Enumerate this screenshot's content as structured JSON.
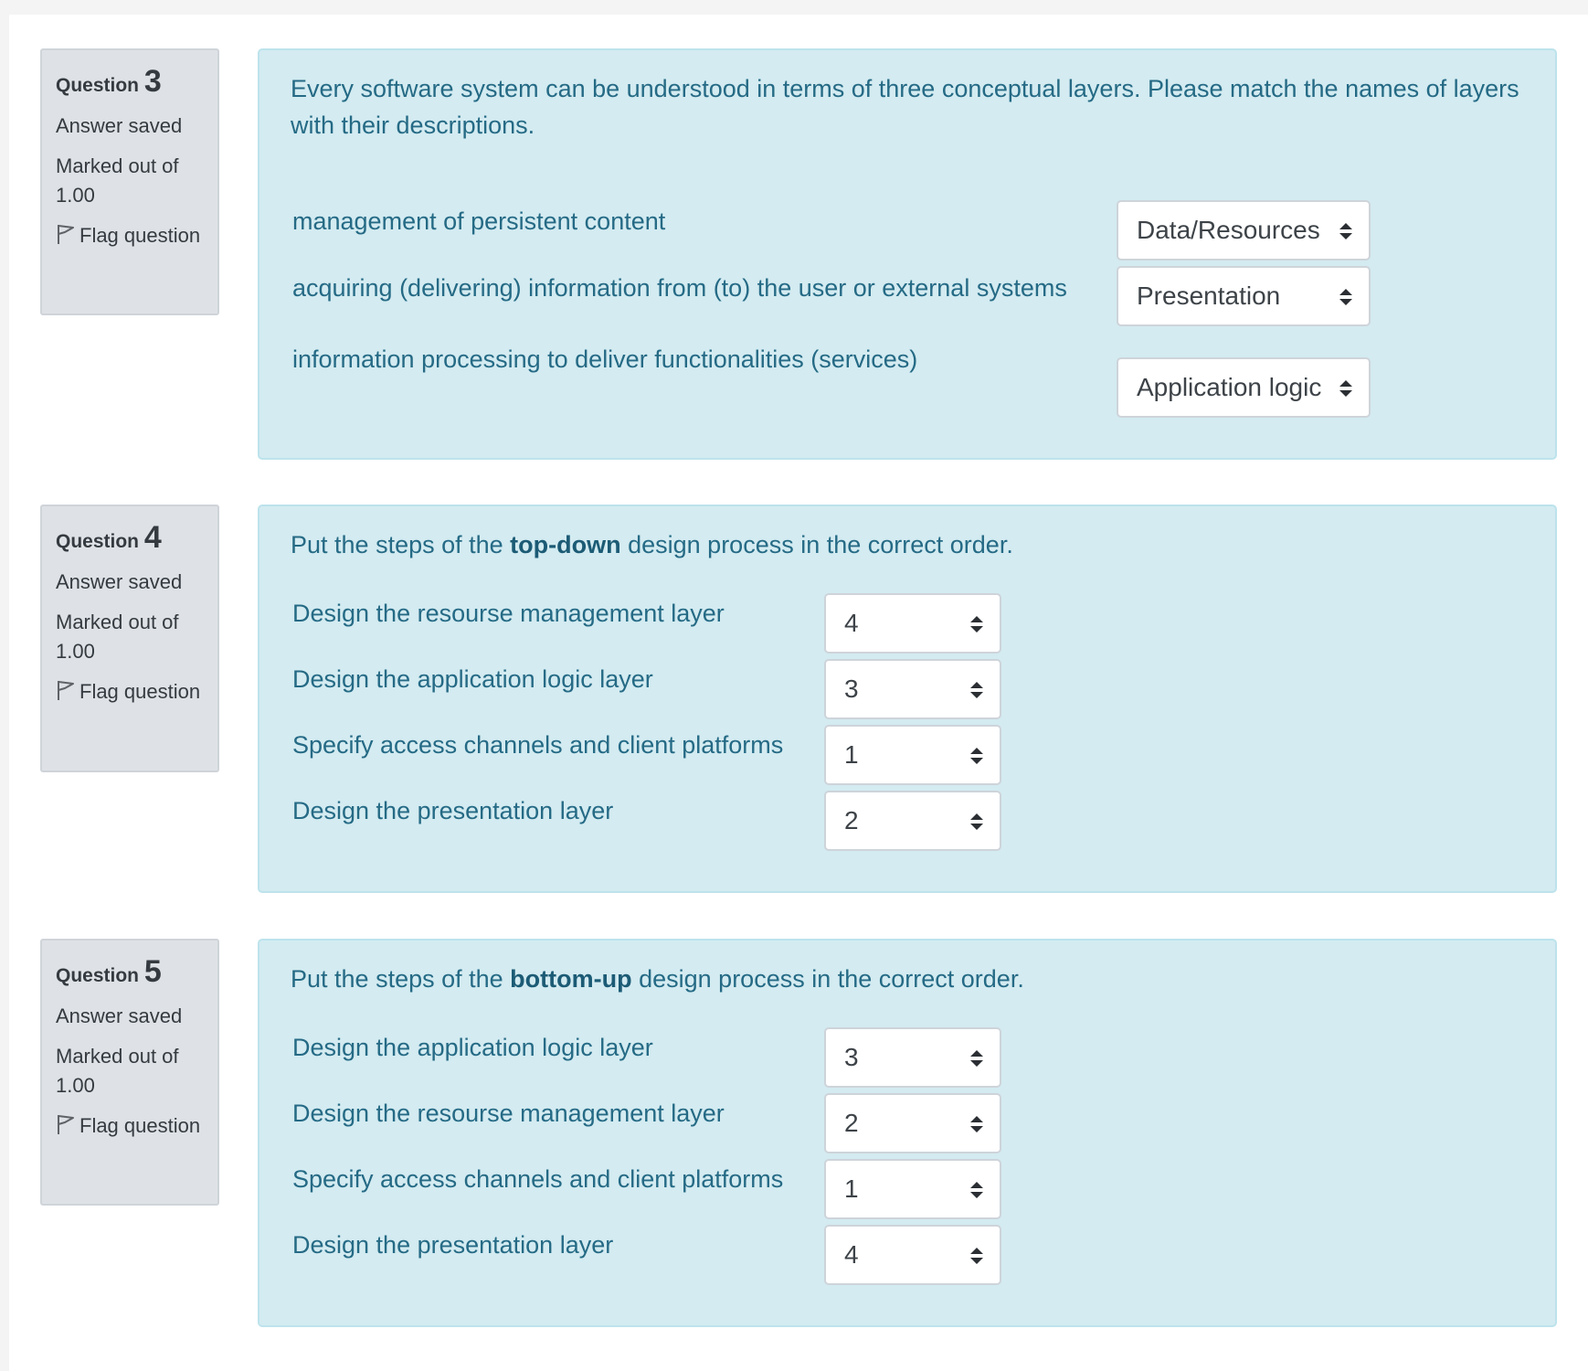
{
  "questions": [
    {
      "label": "Question",
      "number": "3",
      "state": "Answer saved",
      "grade": "Marked out of 1.00",
      "flag_label": "Flag question",
      "text_plain": "Every software system can be understood in terms of three conceptual layers. Please match the names of layers with their descriptions.",
      "rows": [
        {
          "label": "management of persistent content",
          "selected": "Data/Resources"
        },
        {
          "label": "acquiring (delivering) information from (to) the user or external systems",
          "selected": "Presentation"
        },
        {
          "label": "information processing to deliver functionalities (services)",
          "selected": "Application logic"
        }
      ]
    },
    {
      "label": "Question",
      "number": "4",
      "state": "Answer saved",
      "grade": "Marked out of 1.00",
      "flag_label": "Flag question",
      "text_before": "Put the steps of the ",
      "text_bold": "top-down",
      "text_after": " design process in the correct order.",
      "rows": [
        {
          "label": "Design the resourse management layer",
          "selected": "4"
        },
        {
          "label": "Design the application logic layer",
          "selected": "3"
        },
        {
          "label": "Specify access channels and client platforms",
          "selected": "1"
        },
        {
          "label": "Design the presentation layer",
          "selected": "2"
        }
      ]
    },
    {
      "label": "Question",
      "number": "5",
      "state": "Answer saved",
      "grade": "Marked out of 1.00",
      "flag_label": "Flag question",
      "text_before": "Put the steps of the ",
      "text_bold": "bottom-up",
      "text_after": " design process in the correct order.",
      "rows": [
        {
          "label": "Design the application logic layer",
          "selected": "3"
        },
        {
          "label": "Design the resourse management layer",
          "selected": "2"
        },
        {
          "label": "Specify access channels and client platforms",
          "selected": "1"
        },
        {
          "label": "Design the presentation layer",
          "selected": "4"
        }
      ]
    }
  ],
  "colors": {
    "question_background": "#d3ebf1",
    "question_text": "#256a85",
    "info_background": "#dee2e6"
  },
  "icons": {
    "flag": "flag-outline-icon",
    "select_arrows": "sort-up-down-icon"
  }
}
